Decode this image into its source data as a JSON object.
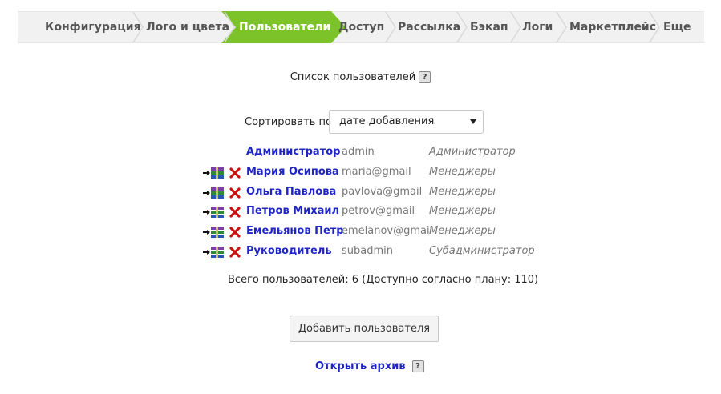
{
  "nav": {
    "tabs": [
      {
        "label": "Конфигурация",
        "active": false
      },
      {
        "label": "Лого и цвета",
        "active": false
      },
      {
        "label": "Пользователи",
        "active": true
      },
      {
        "label": "Доступ",
        "active": false
      },
      {
        "label": "Рассылка",
        "active": false
      },
      {
        "label": "Бэкап",
        "active": false
      },
      {
        "label": "Логи",
        "active": false
      },
      {
        "label": "Маркетплейс",
        "active": false
      },
      {
        "label": "Еще",
        "active": false
      }
    ],
    "active_color": "#7cc32a"
  },
  "main": {
    "title": "Список пользователей",
    "help_glyph": "?",
    "sort": {
      "label": "Сортировать по:",
      "selected": "дате добавления"
    },
    "users": [
      {
        "name": "Администратор",
        "login": "admin",
        "group": "Администратор",
        "actions": false
      },
      {
        "name": "Мария Осипова",
        "login": "maria@gmail",
        "group": "Менеджеры",
        "actions": true
      },
      {
        "name": "Ольга Павлова",
        "login": "pavlova@gmail",
        "group": "Менеджеры",
        "actions": true
      },
      {
        "name": "Петров Михаил",
        "login": "petrov@gmail",
        "group": "Менеджеры",
        "actions": true
      },
      {
        "name": "Емельянов Петр",
        "login": "emelanov@gmail",
        "group": "Менеджеры",
        "actions": true
      },
      {
        "name": "Руководитель",
        "login": "subadmin",
        "group": "Субадминистратор",
        "actions": true
      }
    ],
    "total": "Всего пользователей: 6 (Доступно согласно плану: 110)",
    "add_button": "Добавить пользователя",
    "archive_link": "Открыть архив"
  },
  "icons": {
    "move": "move-to-archive-icon",
    "delete": "delete-x-icon",
    "help": "help-question-icon"
  },
  "colors": {
    "link": "#1f25c4",
    "delete": "#cc1111"
  }
}
